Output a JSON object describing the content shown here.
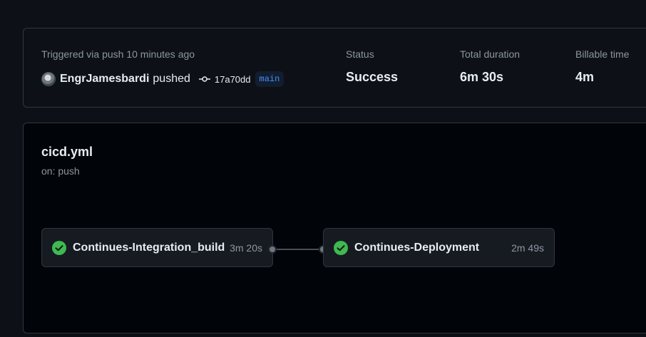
{
  "summary": {
    "trigger_text": "Triggered via push 10 minutes ago",
    "actor": "EngrJamesbardi",
    "action": "pushed",
    "commit_sha": "17a70dd",
    "branch": "main",
    "status_label": "Status",
    "status_value": "Success",
    "duration_label": "Total duration",
    "duration_value": "6m 30s",
    "billable_label": "Billable time",
    "billable_value": "4m"
  },
  "workflow": {
    "name": "cicd.yml",
    "trigger": "on: push",
    "jobs": [
      {
        "name": "Continues-Integration_build",
        "duration": "3m 20s",
        "status": "success"
      },
      {
        "name": "Continues-Deployment",
        "duration": "2m 49s",
        "status": "success"
      }
    ]
  },
  "colors": {
    "success": "#3fb950",
    "accent": "#4493f8",
    "background": "#0d1117"
  },
  "icons": {
    "job_status": "check-circle-icon",
    "commit": "git-commit-icon",
    "avatar": "user-avatar"
  }
}
